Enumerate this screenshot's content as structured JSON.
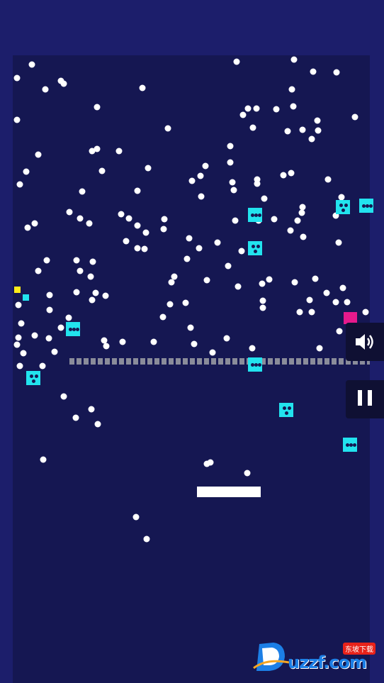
{
  "game": {
    "barrier_segments": 42,
    "ball_color": "#ffffff",
    "block_color": "#22e3ee",
    "background_color": "#151752"
  },
  "blocks": [
    {
      "dots": 3
    },
    {
      "dots": 3
    },
    {
      "dots": 3
    },
    {
      "dots": 3
    },
    {
      "dots": 3
    },
    {
      "dots": 3
    },
    {
      "dots": 3
    },
    {
      "dots": 3
    },
    {
      "dots": 3
    }
  ],
  "controls": {
    "sound_icon": "speaker-icon",
    "pause_icon": "pause-icon"
  },
  "watermark": {
    "text": "uzzf.com",
    "tag": "东坡下载"
  }
}
